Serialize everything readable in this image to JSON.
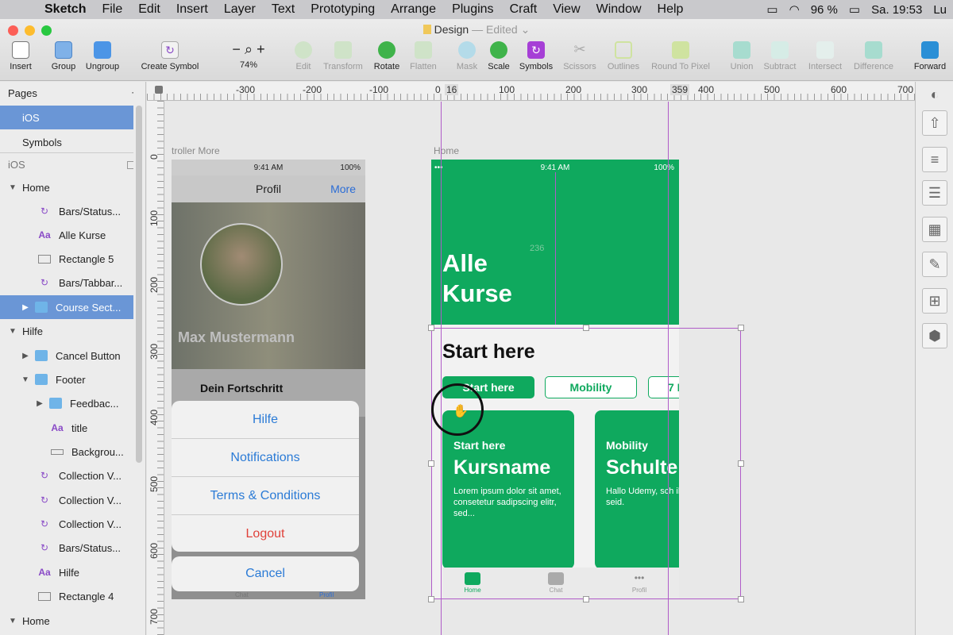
{
  "menubar": {
    "app": "Sketch",
    "items": [
      "File",
      "Edit",
      "Insert",
      "Layer",
      "Text",
      "Prototyping",
      "Arrange",
      "Plugins",
      "Craft",
      "View",
      "Window",
      "Help"
    ],
    "battery": "96 %",
    "clock": "Sa. 19:53",
    "user": "Lu"
  },
  "window": {
    "doc_title": "Design",
    "doc_status": "— Edited ⌄"
  },
  "toolbar": {
    "insert": "Insert",
    "group": "Group",
    "ungroup": "Ungroup",
    "create_symbol": "Create Symbol",
    "zoom_minus": "−",
    "zoom_plus": "+",
    "zoom": "74%",
    "edit": "Edit",
    "transform": "Transform",
    "rotate": "Rotate",
    "flatten": "Flatten",
    "mask": "Mask",
    "scale": "Scale",
    "symbols": "Symbols",
    "scissors": "Scissors",
    "outlines": "Outlines",
    "round_to_pixel": "Round To Pixel",
    "union": "Union",
    "subtract": "Subtract",
    "intersect": "Intersect",
    "difference": "Difference",
    "forward": "Forward"
  },
  "pages_panel": {
    "title": "Pages",
    "add": "+",
    "pages": [
      "iOS",
      "Symbols"
    ],
    "current_page_label": "iOS"
  },
  "layers": [
    {
      "label": "Home",
      "type": "artboard"
    },
    {
      "label": "Bars/Status...",
      "type": "symbol"
    },
    {
      "label": "Alle Kurse",
      "type": "text"
    },
    {
      "label": "Rectangle 5",
      "type": "rect"
    },
    {
      "label": "Bars/Tabbar...",
      "type": "symbol"
    },
    {
      "label": "Course Sect...",
      "type": "folder"
    },
    {
      "label": "Hilfe",
      "type": "artboard"
    },
    {
      "label": "Cancel Button",
      "type": "folder"
    },
    {
      "label": "Footer",
      "type": "folder"
    },
    {
      "label": "Feedbac...",
      "type": "folder"
    },
    {
      "label": "title",
      "type": "text"
    },
    {
      "label": "Backgrou...",
      "type": "rect"
    },
    {
      "label": "Collection V...",
      "type": "symbol"
    },
    {
      "label": "Collection V...",
      "type": "symbol"
    },
    {
      "label": "Collection V...",
      "type": "symbol"
    },
    {
      "label": "Bars/Status...",
      "type": "symbol"
    },
    {
      "label": "Hilfe",
      "type": "text"
    },
    {
      "label": "Rectangle 4",
      "type": "rect"
    },
    {
      "label": "Home",
      "type": "artboard"
    }
  ],
  "ruler_top": [
    "-300",
    "-200",
    "-100",
    "0",
    "16",
    "100",
    "200",
    "300",
    "359",
    "400",
    "500",
    "600",
    "700"
  ],
  "ruler_left": [
    "0",
    "100",
    "200",
    "300",
    "400",
    "500",
    "600",
    "700"
  ],
  "artboard_left": {
    "label": "troller More",
    "time": "9:41 AM",
    "battery": "100%",
    "nav_title": "Profil",
    "nav_more": "More",
    "user_name": "Max Mustermann",
    "progress_label": "Dein Fortschritt",
    "sheet_items": [
      "Hilfe",
      "Notifications",
      "Terms & Conditions",
      "Logout"
    ],
    "cancel": "Cancel",
    "tabs": [
      "Chat",
      "Profil"
    ]
  },
  "artboard_right": {
    "label": "Home",
    "time": "9:41 AM",
    "battery": "100%",
    "hero_title": "Alle Kurse",
    "measure": "236",
    "section_title": "Start here",
    "chips": [
      "Start here",
      "Mobility",
      "7 I"
    ],
    "cards": [
      {
        "sub": "Start here",
        "name": "Kursname",
        "desc": "Lorem ipsum dolor sit amet, consetetur sadipscing elitr, sed..."
      },
      {
        "sub": "Mobility",
        "name": "Schulte",
        "desc": "Hallo Udemy, sch ihr hier seid."
      }
    ],
    "tabs": [
      "Home",
      "Chat",
      "Profil"
    ]
  },
  "colors": {
    "brand_green": "#0fa95e",
    "selection_blue": "#6a96d6",
    "guide_magenta": "#b05cc8",
    "link_blue": "#2b7bd6",
    "logout_red": "#e0413a"
  }
}
